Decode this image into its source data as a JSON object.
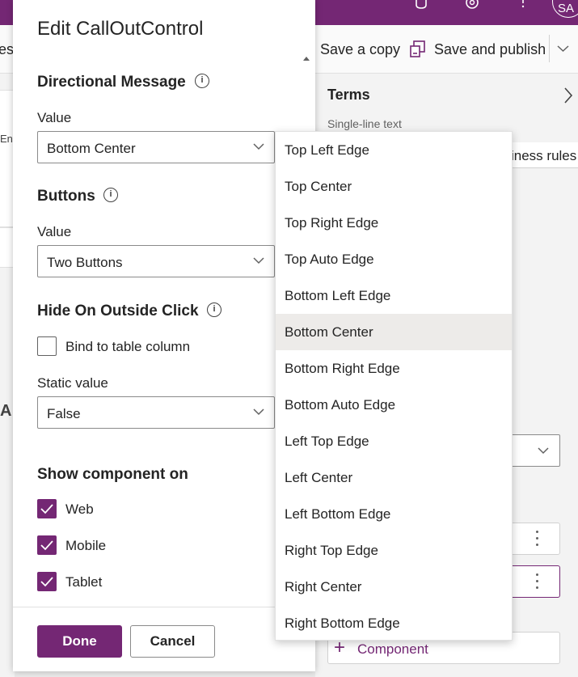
{
  "topbar": {
    "avatar_initials": "SA"
  },
  "commandbar": {
    "cut_left_label": "es",
    "save_copy_label": "Save a copy",
    "save_publish_label": "Save and publish"
  },
  "left_fragments": {
    "frag1": "En",
    "frag2": "A"
  },
  "right_panel": {
    "title": "Terms",
    "subtitle": "Single-line text",
    "tab_label": "iness rules",
    "component_label": "Component"
  },
  "edit_panel": {
    "title": "Edit CallOutControl",
    "directional": {
      "heading": "Directional Message",
      "value_label": "Value",
      "value": "Bottom Center"
    },
    "buttons": {
      "heading": "Buttons",
      "value_label": "Value",
      "value": "Two Buttons"
    },
    "hide": {
      "heading": "Hide On Outside Click",
      "bind_label": "Bind to table column",
      "bind_checked": false,
      "static_label": "Static value",
      "static_value": "False"
    },
    "show_on": {
      "heading": "Show component on",
      "options": [
        {
          "label": "Web",
          "checked": true
        },
        {
          "label": "Mobile",
          "checked": true
        },
        {
          "label": "Tablet",
          "checked": true
        }
      ]
    },
    "footer": {
      "done_label": "Done",
      "cancel_label": "Cancel"
    }
  },
  "dropdown": {
    "selected": "Bottom Center",
    "options": [
      "Top Left Edge",
      "Top Center",
      "Top Right Edge",
      "Top Auto Edge",
      "Bottom Left Edge",
      "Bottom Center",
      "Bottom Right Edge",
      "Bottom Auto Edge",
      "Left Top Edge",
      "Left Center",
      "Left Bottom Edge",
      "Right Top Edge",
      "Right Center",
      "Right Bottom Edge"
    ]
  },
  "colors": {
    "brand": "#742774",
    "selected_option_bg": "#edebe9"
  }
}
